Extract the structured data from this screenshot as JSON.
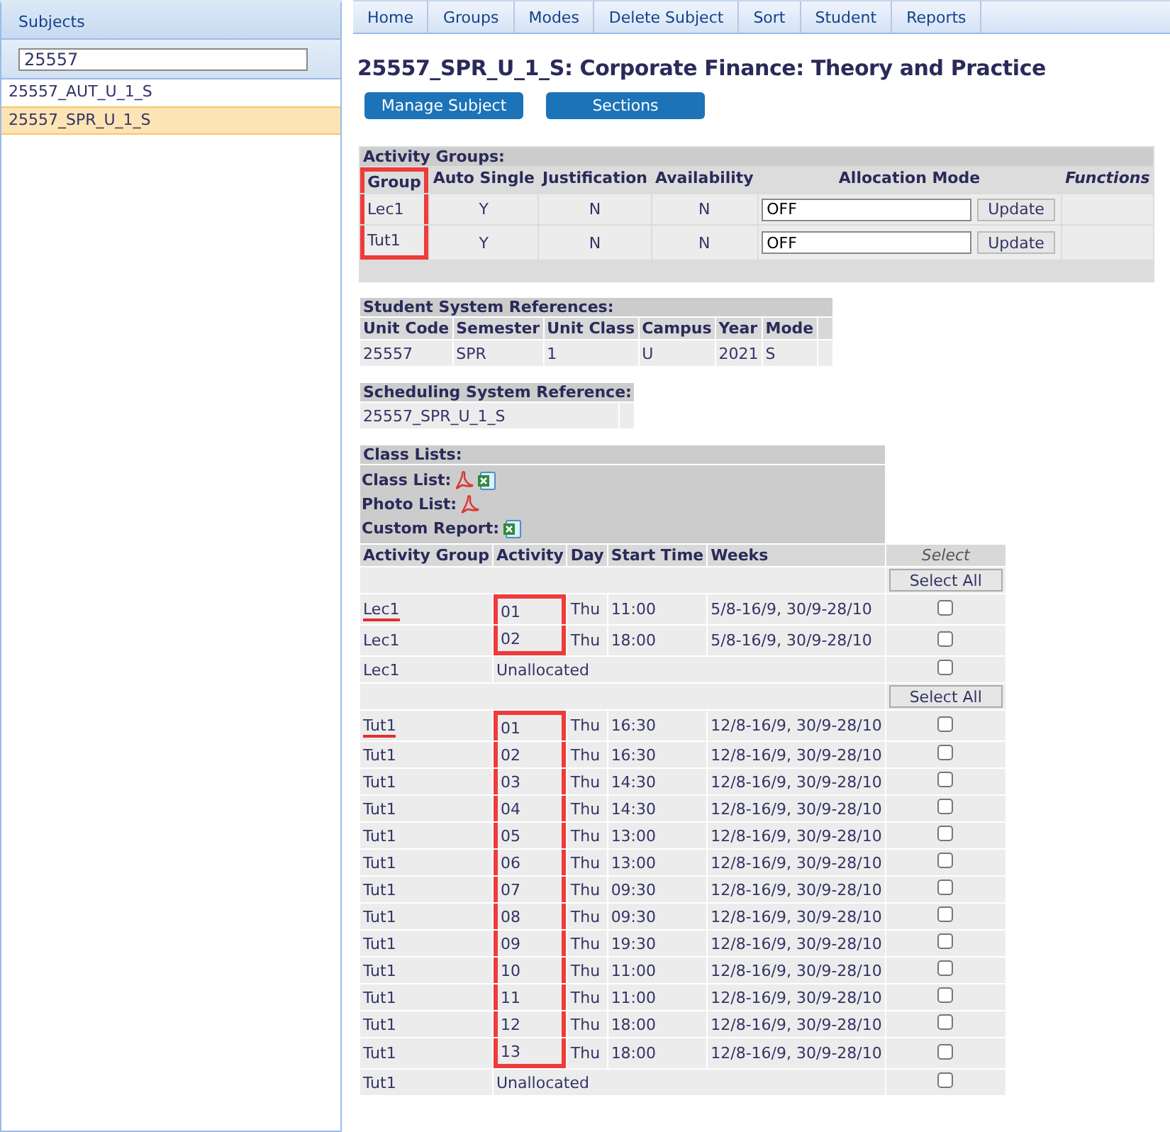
{
  "sidebar": {
    "title": "Subjects",
    "search": {
      "value": "25557"
    },
    "items": [
      {
        "label": "25557_AUT_U_1_S",
        "selected": false
      },
      {
        "label": "25557_SPR_U_1_S",
        "selected": true
      }
    ]
  },
  "nav": [
    "Home",
    "Groups",
    "Modes",
    "Delete Subject",
    "Sort",
    "Student",
    "Reports"
  ],
  "heading": "25557_SPR_U_1_S: Corporate Finance: Theory and Practice",
  "buttons": [
    "Manage Subject",
    "Sections"
  ],
  "activity_groups": {
    "title": "Activity Groups:",
    "columns": [
      "Group",
      "Auto Single",
      "Justification",
      "Availability",
      "Allocation Mode",
      "Functions"
    ],
    "group_column_marked": true,
    "rows": [
      {
        "group": "Lec1",
        "auto_single": "Y",
        "justification": "N",
        "availability": "N",
        "allocation_mode": "OFF",
        "button": "Update"
      },
      {
        "group": "Tut1",
        "auto_single": "Y",
        "justification": "N",
        "availability": "N",
        "allocation_mode": "OFF",
        "button": "Update"
      }
    ]
  },
  "student_system_references": {
    "title": "Student System References:",
    "columns": [
      "Unit Code",
      "Semester",
      "Unit Class",
      "Campus",
      "Year",
      "Mode"
    ],
    "values": [
      "25557",
      "SPR",
      "1",
      "U",
      "2021",
      "S"
    ]
  },
  "scheduling_system_reference": {
    "title": "Scheduling System Reference:",
    "value": "25557_SPR_U_1_S"
  },
  "class_lists": {
    "title": "Class Lists:",
    "reports": [
      {
        "label": "Class List:",
        "icons": [
          {
            "kind": "pdf"
          },
          {
            "kind": "spreadsheet"
          }
        ]
      },
      {
        "label": "Photo List:",
        "icons": [
          {
            "kind": "pdf"
          }
        ]
      },
      {
        "label": "Custom Report:",
        "icons": [
          {
            "kind": "spreadsheet"
          }
        ]
      }
    ],
    "columns": [
      "Activity Group",
      "Activity",
      "Day",
      "Start Time",
      "Weeks"
    ],
    "select_header": "Select",
    "sections": [
      {
        "select_all": "Select All",
        "rows": [
          {
            "kind": "scheduled",
            "group": "Lec1",
            "underlined": true,
            "activity": "01",
            "marked": true,
            "day": "Thu",
            "start": "11:00",
            "weeks": "5/8-16/9, 30/9-28/10",
            "checked": false
          },
          {
            "kind": "scheduled",
            "group": "Lec1",
            "underlined": false,
            "activity": "02",
            "marked": true,
            "day": "Thu",
            "start": "18:00",
            "weeks": "5/8-16/9, 30/9-28/10",
            "checked": false
          },
          {
            "kind": "unallocated",
            "group": "Lec1",
            "underlined": false,
            "activity": "Unallocated",
            "checked": false
          }
        ]
      },
      {
        "select_all": "Select All",
        "rows": [
          {
            "kind": "scheduled",
            "group": "Tut1",
            "underlined": true,
            "activity": "01",
            "marked": true,
            "day": "Thu",
            "start": "16:30",
            "weeks": "12/8-16/9, 30/9-28/10",
            "checked": false
          },
          {
            "kind": "scheduled",
            "group": "Tut1",
            "underlined": false,
            "activity": "02",
            "marked": true,
            "day": "Thu",
            "start": "16:30",
            "weeks": "12/8-16/9, 30/9-28/10",
            "checked": false
          },
          {
            "kind": "scheduled",
            "group": "Tut1",
            "underlined": false,
            "activity": "03",
            "marked": true,
            "day": "Thu",
            "start": "14:30",
            "weeks": "12/8-16/9, 30/9-28/10",
            "checked": false
          },
          {
            "kind": "scheduled",
            "group": "Tut1",
            "underlined": false,
            "activity": "04",
            "marked": true,
            "day": "Thu",
            "start": "14:30",
            "weeks": "12/8-16/9, 30/9-28/10",
            "checked": false
          },
          {
            "kind": "scheduled",
            "group": "Tut1",
            "underlined": false,
            "activity": "05",
            "marked": true,
            "day": "Thu",
            "start": "13:00",
            "weeks": "12/8-16/9, 30/9-28/10",
            "checked": false
          },
          {
            "kind": "scheduled",
            "group": "Tut1",
            "underlined": false,
            "activity": "06",
            "marked": true,
            "day": "Thu",
            "start": "13:00",
            "weeks": "12/8-16/9, 30/9-28/10",
            "checked": false
          },
          {
            "kind": "scheduled",
            "group": "Tut1",
            "underlined": false,
            "activity": "07",
            "marked": true,
            "day": "Thu",
            "start": "09:30",
            "weeks": "12/8-16/9, 30/9-28/10",
            "checked": false
          },
          {
            "kind": "scheduled",
            "group": "Tut1",
            "underlined": false,
            "activity": "08",
            "marked": true,
            "day": "Thu",
            "start": "09:30",
            "weeks": "12/8-16/9, 30/9-28/10",
            "checked": false
          },
          {
            "kind": "scheduled",
            "group": "Tut1",
            "underlined": false,
            "activity": "09",
            "marked": true,
            "day": "Thu",
            "start": "19:30",
            "weeks": "12/8-16/9, 30/9-28/10",
            "checked": false
          },
          {
            "kind": "scheduled",
            "group": "Tut1",
            "underlined": false,
            "activity": "10",
            "marked": true,
            "day": "Thu",
            "start": "11:00",
            "weeks": "12/8-16/9, 30/9-28/10",
            "checked": false
          },
          {
            "kind": "scheduled",
            "group": "Tut1",
            "underlined": false,
            "activity": "11",
            "marked": true,
            "day": "Thu",
            "start": "11:00",
            "weeks": "12/8-16/9, 30/9-28/10",
            "checked": false
          },
          {
            "kind": "scheduled",
            "group": "Tut1",
            "underlined": false,
            "activity": "12",
            "marked": true,
            "day": "Thu",
            "start": "18:00",
            "weeks": "12/8-16/9, 30/9-28/10",
            "checked": false
          },
          {
            "kind": "scheduled",
            "group": "Tut1",
            "underlined": false,
            "activity": "13",
            "marked": true,
            "day": "Thu",
            "start": "18:00",
            "weeks": "12/8-16/9, 30/9-28/10",
            "checked": false
          },
          {
            "kind": "unallocated",
            "group": "Tut1",
            "underlined": false,
            "activity": "Unallocated",
            "checked": false
          }
        ]
      }
    ]
  }
}
